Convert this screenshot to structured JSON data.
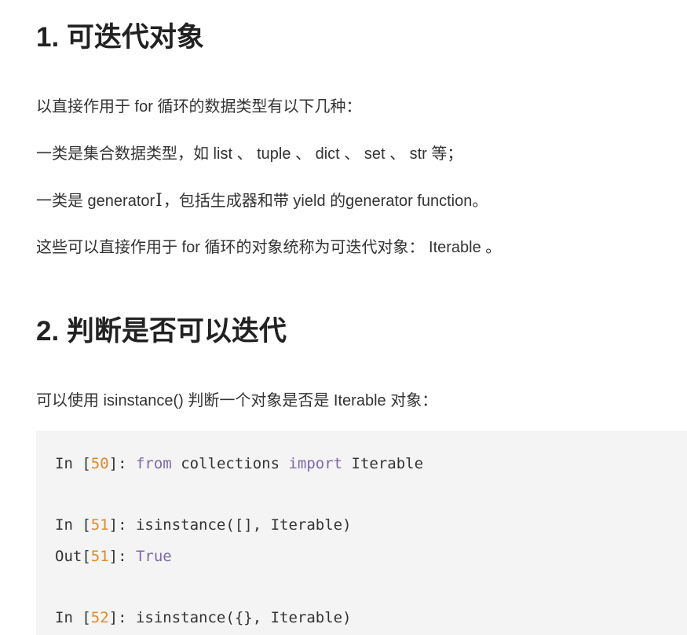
{
  "section1": {
    "heading": "1. 可迭代对象",
    "paragraphs": [
      "以直接作用于 for 循环的数据类型有以下几种：",
      "一类是集合数据类型，如 list 、 tuple 、 dict 、 set 、 str 等；",
      "一类是 generator",
      "，包括生成器和带 yield 的generator function。",
      "这些可以直接作用于 for 循环的对象统称为可迭代对象： Iterable 。"
    ]
  },
  "section2": {
    "heading": "2. 判断是否可以迭代",
    "paragraph": "可以使用 isinstance() 判断一个对象是否是 Iterable 对象："
  },
  "code": {
    "line1": {
      "pre": "In [",
      "n": "50",
      "post": "]: ",
      "kw1": "from",
      "mid": " collections ",
      "kw2": "import",
      "end": " Iterable"
    },
    "line2": {
      "pre": "In [",
      "n": "51",
      "post": "]: ",
      "end": "isinstance([], Iterable)"
    },
    "line3": {
      "pre": "Out[",
      "n": "51",
      "post": "]: ",
      "kw1": "True"
    },
    "line4": {
      "pre": "In [",
      "n": "52",
      "post": "]: ",
      "end": "isinstance({}, Iterable)"
    }
  },
  "cursor_glyph": "I"
}
